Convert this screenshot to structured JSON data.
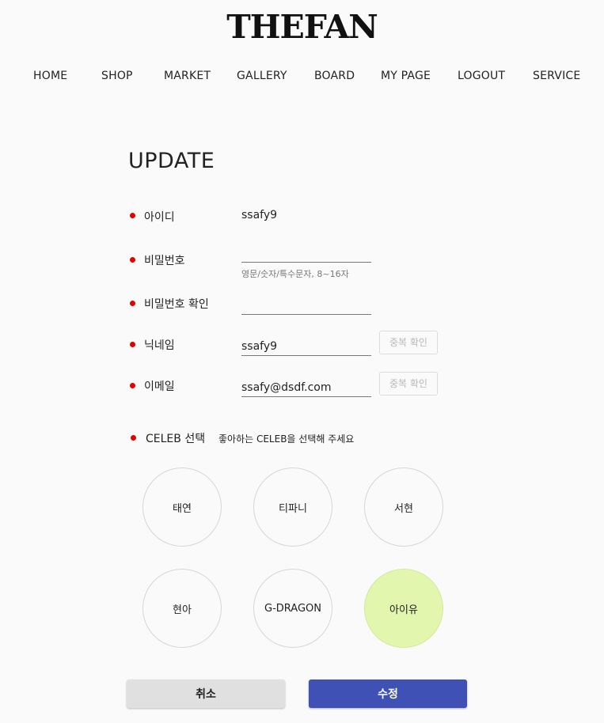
{
  "brand": {
    "logo_text": "THEFAN"
  },
  "nav": {
    "items": [
      {
        "label": "HOME"
      },
      {
        "label": "SHOP"
      },
      {
        "label": "MARKET"
      },
      {
        "label": "GALLERY"
      },
      {
        "label": "BOARD"
      },
      {
        "label": "MY PAGE"
      },
      {
        "label": "LOGOUT"
      },
      {
        "label": "SERVICE"
      }
    ]
  },
  "page": {
    "title": "UPDATE"
  },
  "form": {
    "id": {
      "label": "아이디",
      "value": "ssafy9"
    },
    "password": {
      "label": "비밀번호",
      "value": "",
      "hint": "영문/숫자/특수문자, 8~16자"
    },
    "password_confirm": {
      "label": "비밀번호 확인",
      "value": ""
    },
    "nickname": {
      "label": "닉네임",
      "value": "ssafy9",
      "check_label": "중복 확인"
    },
    "email": {
      "label": "이메일",
      "value": "ssafy@dsdf.com",
      "check_label": "중복 확인"
    },
    "required_dot_color": "#e00000"
  },
  "celeb": {
    "label": "CELEB 선택",
    "hint": "좋아하는 CELEB을 선택해 주세요",
    "options": [
      {
        "name": "태연",
        "selected": false
      },
      {
        "name": "티파니",
        "selected": false
      },
      {
        "name": "서현",
        "selected": false
      },
      {
        "name": "현아",
        "selected": false
      },
      {
        "name": "G-DRAGON",
        "selected": false
      },
      {
        "name": "아이유",
        "selected": true
      }
    ],
    "selected_color": "#e2f6ad"
  },
  "actions": {
    "cancel_label": "취소",
    "submit_label": "수정",
    "submit_color": "#3f51b5"
  }
}
